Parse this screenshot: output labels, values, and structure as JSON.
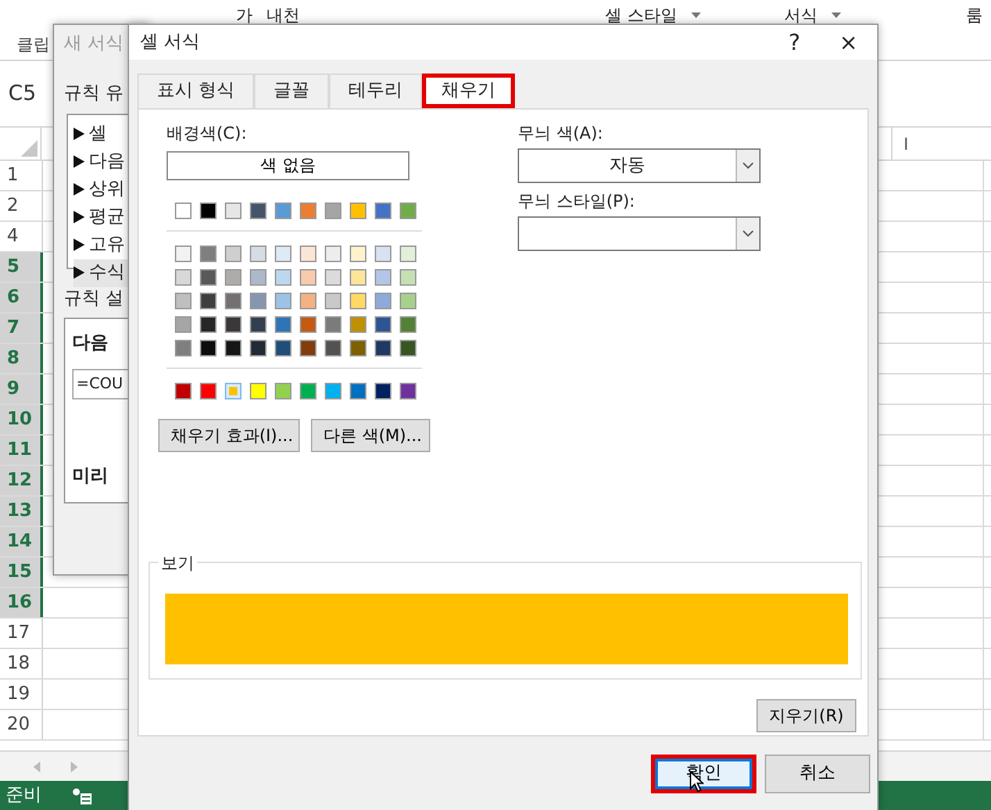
{
  "ribbon": {
    "font_color_button": "가",
    "wrap_label": "내천",
    "cell_style_button": "셀 스타일",
    "format_button": "서식",
    "group_label": "클립",
    "edge_label": "룸"
  },
  "sheet": {
    "name_box": "C5",
    "column_headers": [
      "I"
    ],
    "rows": [
      {
        "label": "1",
        "selected": false
      },
      {
        "label": "2",
        "selected": false
      },
      {
        "label": "4",
        "selected": false
      },
      {
        "label": "5",
        "selected": true
      },
      {
        "label": "6",
        "selected": true
      },
      {
        "label": "7",
        "selected": true
      },
      {
        "label": "8",
        "selected": true
      },
      {
        "label": "9",
        "selected": true
      },
      {
        "label": "10",
        "selected": true
      },
      {
        "label": "11",
        "selected": true
      },
      {
        "label": "12",
        "selected": true
      },
      {
        "label": "13",
        "selected": true
      },
      {
        "label": "14",
        "selected": true
      },
      {
        "label": "15",
        "selected": true
      },
      {
        "label": "16",
        "selected": true
      },
      {
        "label": "17",
        "selected": false
      },
      {
        "label": "18",
        "selected": false
      },
      {
        "label": "19",
        "selected": false
      },
      {
        "label": "20",
        "selected": false
      }
    ]
  },
  "status_bar": {
    "text": "준비"
  },
  "rule_dialog": {
    "title": "새 서식",
    "section_label": "규칙 유",
    "rule_types": [
      {
        "label": "셀",
        "selected": false
      },
      {
        "label": "다음",
        "selected": false
      },
      {
        "label": "상위",
        "selected": false
      },
      {
        "label": "평균",
        "selected": false
      },
      {
        "label": "고유",
        "selected": false
      },
      {
        "label": "수식",
        "selected": true
      }
    ],
    "description_label": "규칙 설",
    "formula_label": "다음",
    "formula_value": "=COU",
    "preview_label": "미리"
  },
  "format_dialog": {
    "title": "셀 서식",
    "help": "?",
    "close": "×",
    "tabs": [
      {
        "label": "표시 형식",
        "selected": false,
        "highlighted": false
      },
      {
        "label": "글꼴",
        "selected": false,
        "highlighted": false
      },
      {
        "label": "테두리",
        "selected": false,
        "highlighted": false
      },
      {
        "label": "채우기",
        "selected": true,
        "highlighted": true
      }
    ],
    "background_label": "배경색(C):",
    "no_color_button": "색 없음",
    "theme_colors": [
      {
        "color": "#ffffff",
        "selected": false
      },
      {
        "color": "#000000",
        "selected": false
      },
      {
        "color": "#e7e6e6",
        "selected": false
      },
      {
        "color": "#44546a",
        "selected": false
      },
      {
        "color": "#5b9bd5",
        "selected": false
      },
      {
        "color": "#ed7d31",
        "selected": false
      },
      {
        "color": "#a5a5a5",
        "selected": false
      },
      {
        "color": "#ffc000",
        "selected": false
      },
      {
        "color": "#4472c4",
        "selected": false
      },
      {
        "color": "#70ad47",
        "selected": false
      }
    ],
    "shades": [
      [
        {
          "color": "#f2f2f2",
          "selected": false
        },
        {
          "color": "#7f7f7f",
          "selected": false
        },
        {
          "color": "#d0cece",
          "selected": false
        },
        {
          "color": "#d6dce4",
          "selected": false
        },
        {
          "color": "#deebf6",
          "selected": false
        },
        {
          "color": "#fbe5d5",
          "selected": false
        },
        {
          "color": "#ededed",
          "selected": false
        },
        {
          "color": "#fff2cc",
          "selected": false
        },
        {
          "color": "#d9e2f3",
          "selected": false
        },
        {
          "color": "#e2efd9",
          "selected": false
        }
      ],
      [
        {
          "color": "#d8d8d8",
          "selected": false
        },
        {
          "color": "#595959",
          "selected": false
        },
        {
          "color": "#aeabab",
          "selected": false
        },
        {
          "color": "#adb9ca",
          "selected": false
        },
        {
          "color": "#bdd7ee",
          "selected": false
        },
        {
          "color": "#f7cbac",
          "selected": false
        },
        {
          "color": "#dbdbdb",
          "selected": false
        },
        {
          "color": "#fee599",
          "selected": false
        },
        {
          "color": "#b4c6e7",
          "selected": false
        },
        {
          "color": "#c5e0b3",
          "selected": false
        }
      ],
      [
        {
          "color": "#bfbfbf",
          "selected": false
        },
        {
          "color": "#3f3f3f",
          "selected": false
        },
        {
          "color": "#757070",
          "selected": false
        },
        {
          "color": "#8496b0",
          "selected": false
        },
        {
          "color": "#9cc3e5",
          "selected": false
        },
        {
          "color": "#f4b183",
          "selected": false
        },
        {
          "color": "#c9c9c9",
          "selected": false
        },
        {
          "color": "#ffd965",
          "selected": false
        },
        {
          "color": "#8eaadb",
          "selected": false
        },
        {
          "color": "#a8d08d",
          "selected": false
        }
      ],
      [
        {
          "color": "#a5a5a5",
          "selected": false
        },
        {
          "color": "#262626",
          "selected": false
        },
        {
          "color": "#3a3838",
          "selected": false
        },
        {
          "color": "#323f4f",
          "selected": false
        },
        {
          "color": "#2e75b5",
          "selected": false
        },
        {
          "color": "#c55a11",
          "selected": false
        },
        {
          "color": "#7b7b7b",
          "selected": false
        },
        {
          "color": "#bf9000",
          "selected": false
        },
        {
          "color": "#2f5496",
          "selected": false
        },
        {
          "color": "#538135",
          "selected": false
        }
      ],
      [
        {
          "color": "#7f7f7f",
          "selected": false
        },
        {
          "color": "#0c0c0c",
          "selected": false
        },
        {
          "color": "#171616",
          "selected": false
        },
        {
          "color": "#222a35",
          "selected": false
        },
        {
          "color": "#1e4e79",
          "selected": false
        },
        {
          "color": "#833c0b",
          "selected": false
        },
        {
          "color": "#525252",
          "selected": false
        },
        {
          "color": "#7f6000",
          "selected": false
        },
        {
          "color": "#1f3864",
          "selected": false
        },
        {
          "color": "#375623",
          "selected": false
        }
      ]
    ],
    "standard_colors": [
      {
        "color": "#c00000",
        "selected": false
      },
      {
        "color": "#ff0000",
        "selected": false
      },
      {
        "color": "#ffc000",
        "selected": true
      },
      {
        "color": "#ffff00",
        "selected": false
      },
      {
        "color": "#92d050",
        "selected": false
      },
      {
        "color": "#00b050",
        "selected": false
      },
      {
        "color": "#00b0f0",
        "selected": false
      },
      {
        "color": "#0070c0",
        "selected": false
      },
      {
        "color": "#002060",
        "selected": false
      },
      {
        "color": "#7030a0",
        "selected": false
      }
    ],
    "fill_effects_button": "채우기 효과(I)...",
    "more_colors_button": "다른 색(M)...",
    "pattern_color_label": "무늬 색(A):",
    "pattern_color_value": "자동",
    "pattern_style_label": "무늬 스타일(P):",
    "preview": {
      "label": "보기",
      "color": "#ffc000"
    },
    "clear_button": "지우기(R)",
    "footer_buttons": [
      {
        "label": "확인",
        "default": true,
        "highlighted": true
      },
      {
        "label": "취소",
        "default": false,
        "highlighted": false
      }
    ]
  }
}
